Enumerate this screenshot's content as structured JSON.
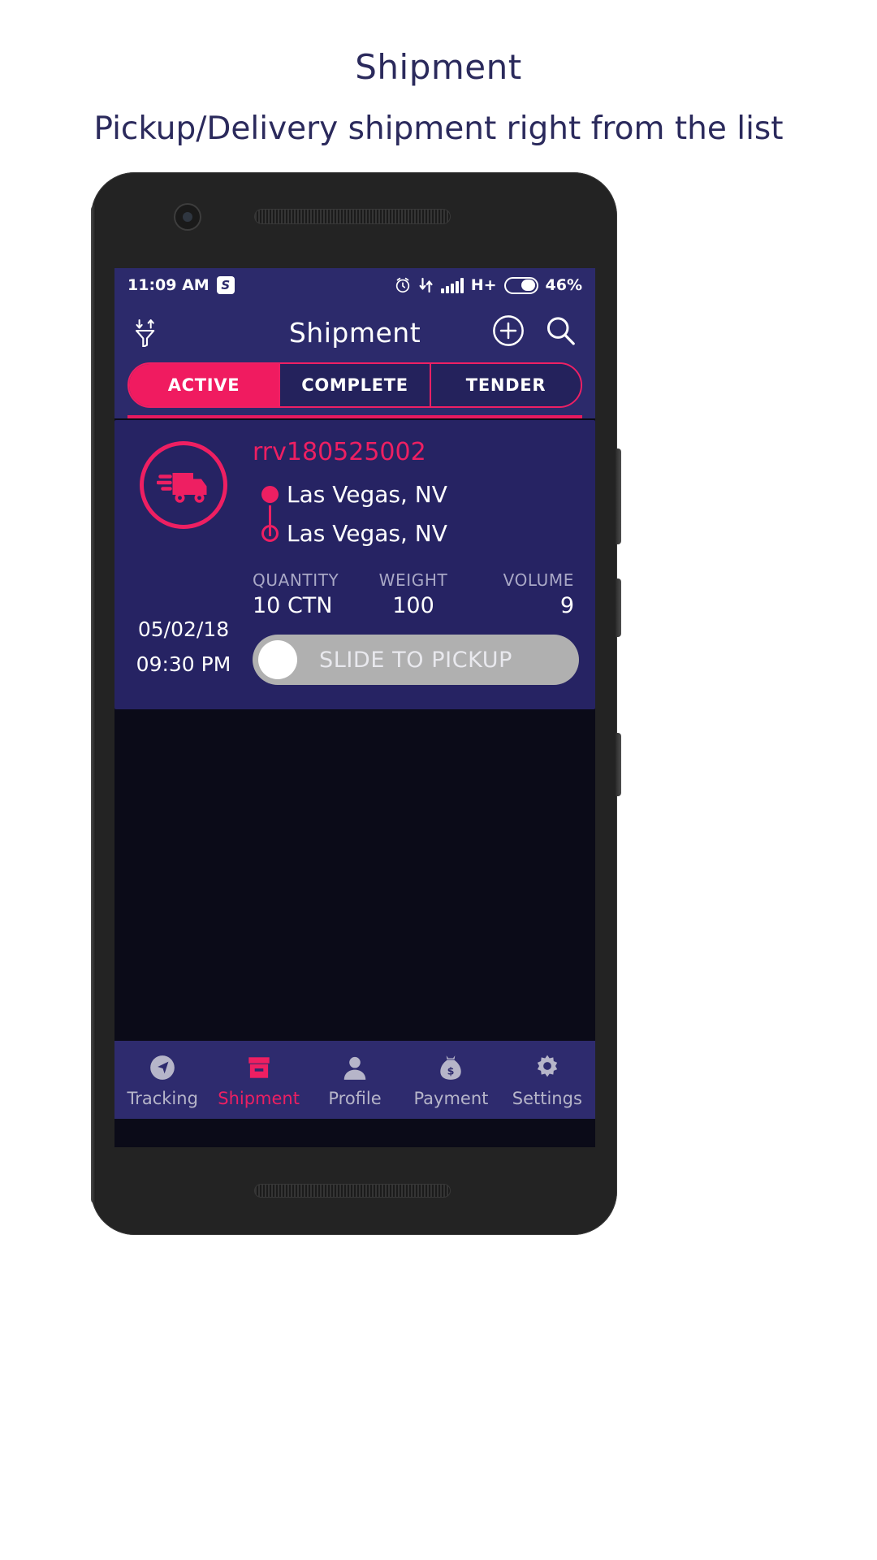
{
  "promo": {
    "title": "Shipment",
    "subtitle": "Pickup/Delivery shipment right from the list"
  },
  "statusbar": {
    "time": "11:09 AM",
    "app_badge": "S",
    "network": "H+",
    "battery_percent": "46%",
    "icons": [
      "alarm-icon",
      "sync-arrows-icon",
      "signal-bars-icon",
      "battery-icon"
    ]
  },
  "appbar": {
    "title": "Shipment",
    "filter_icon": "filter-sort-icon",
    "add_icon": "plus-circle-icon",
    "search_icon": "search-icon"
  },
  "tabs": [
    {
      "label": "ACTIVE",
      "active": true
    },
    {
      "label": "COMPLETE",
      "active": false
    },
    {
      "label": "TENDER",
      "active": false
    }
  ],
  "card": {
    "icon": "delivery-truck-icon",
    "shipment_id": "rrv180525002",
    "origin": "Las Vegas, NV",
    "destination": "Las Vegas, NV",
    "date": "05/02/18",
    "time": "09:30 PM",
    "metrics": [
      {
        "label": "QUANTITY",
        "value": "10 CTN"
      },
      {
        "label": "WEIGHT",
        "value": "100"
      },
      {
        "label": "VOLUME",
        "value": "9"
      }
    ],
    "slider_label": "SLIDE TO PICKUP"
  },
  "bottomnav": [
    {
      "label": "Tracking",
      "icon": "navigation-compass-icon",
      "active": false
    },
    {
      "label": "Shipment",
      "icon": "box-icon",
      "active": true
    },
    {
      "label": "Profile",
      "icon": "person-icon",
      "active": false
    },
    {
      "label": "Payment",
      "icon": "money-bag-icon",
      "active": false
    },
    {
      "label": "Settings",
      "icon": "gear-icon",
      "active": false
    }
  ],
  "colors": {
    "accent_pink": "#ee1f62",
    "header_navy": "#2c2a6b",
    "card_navy": "#262363",
    "screen_bg": "#0b0b18",
    "promo_text": "#2b2a5c"
  }
}
